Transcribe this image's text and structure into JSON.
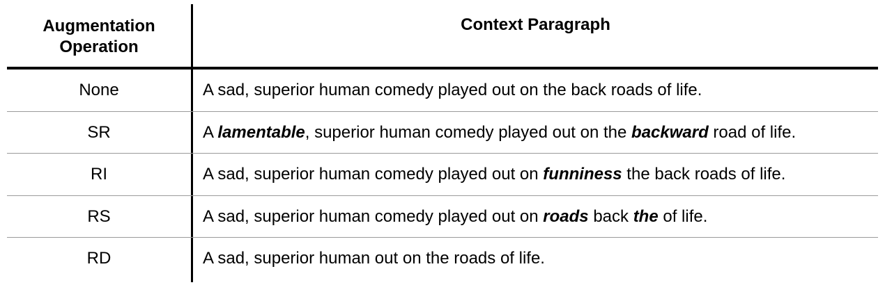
{
  "table": {
    "headers": {
      "operation_line1": "Augmentation",
      "operation_line2": "Operation",
      "context": "Context Paragraph"
    },
    "rows": [
      {
        "operation": "None",
        "segments": [
          {
            "text": "A sad, superior human comedy played out on the back roads of life.",
            "emphasis": false
          }
        ]
      },
      {
        "operation": "SR",
        "segments": [
          {
            "text": "A ",
            "emphasis": false
          },
          {
            "text": "lamentable",
            "emphasis": true
          },
          {
            "text": ", superior human comedy played out on the ",
            "emphasis": false
          },
          {
            "text": "backward",
            "emphasis": true
          },
          {
            "text": " road of life.",
            "emphasis": false
          }
        ]
      },
      {
        "operation": "RI",
        "segments": [
          {
            "text": "A sad, superior human comedy played out on ",
            "emphasis": false
          },
          {
            "text": "funniness",
            "emphasis": true
          },
          {
            "text": " the back roads of life.",
            "emphasis": false
          }
        ]
      },
      {
        "operation": "RS",
        "segments": [
          {
            "text": "A sad, superior human comedy played out on ",
            "emphasis": false
          },
          {
            "text": "roads",
            "emphasis": true
          },
          {
            "text": " back ",
            "emphasis": false
          },
          {
            "text": "the",
            "emphasis": true
          },
          {
            "text": " of life.",
            "emphasis": false
          }
        ]
      },
      {
        "operation": "RD",
        "segments": [
          {
            "text": "A sad, superior human out on the roads of life.",
            "emphasis": false
          }
        ]
      }
    ]
  }
}
